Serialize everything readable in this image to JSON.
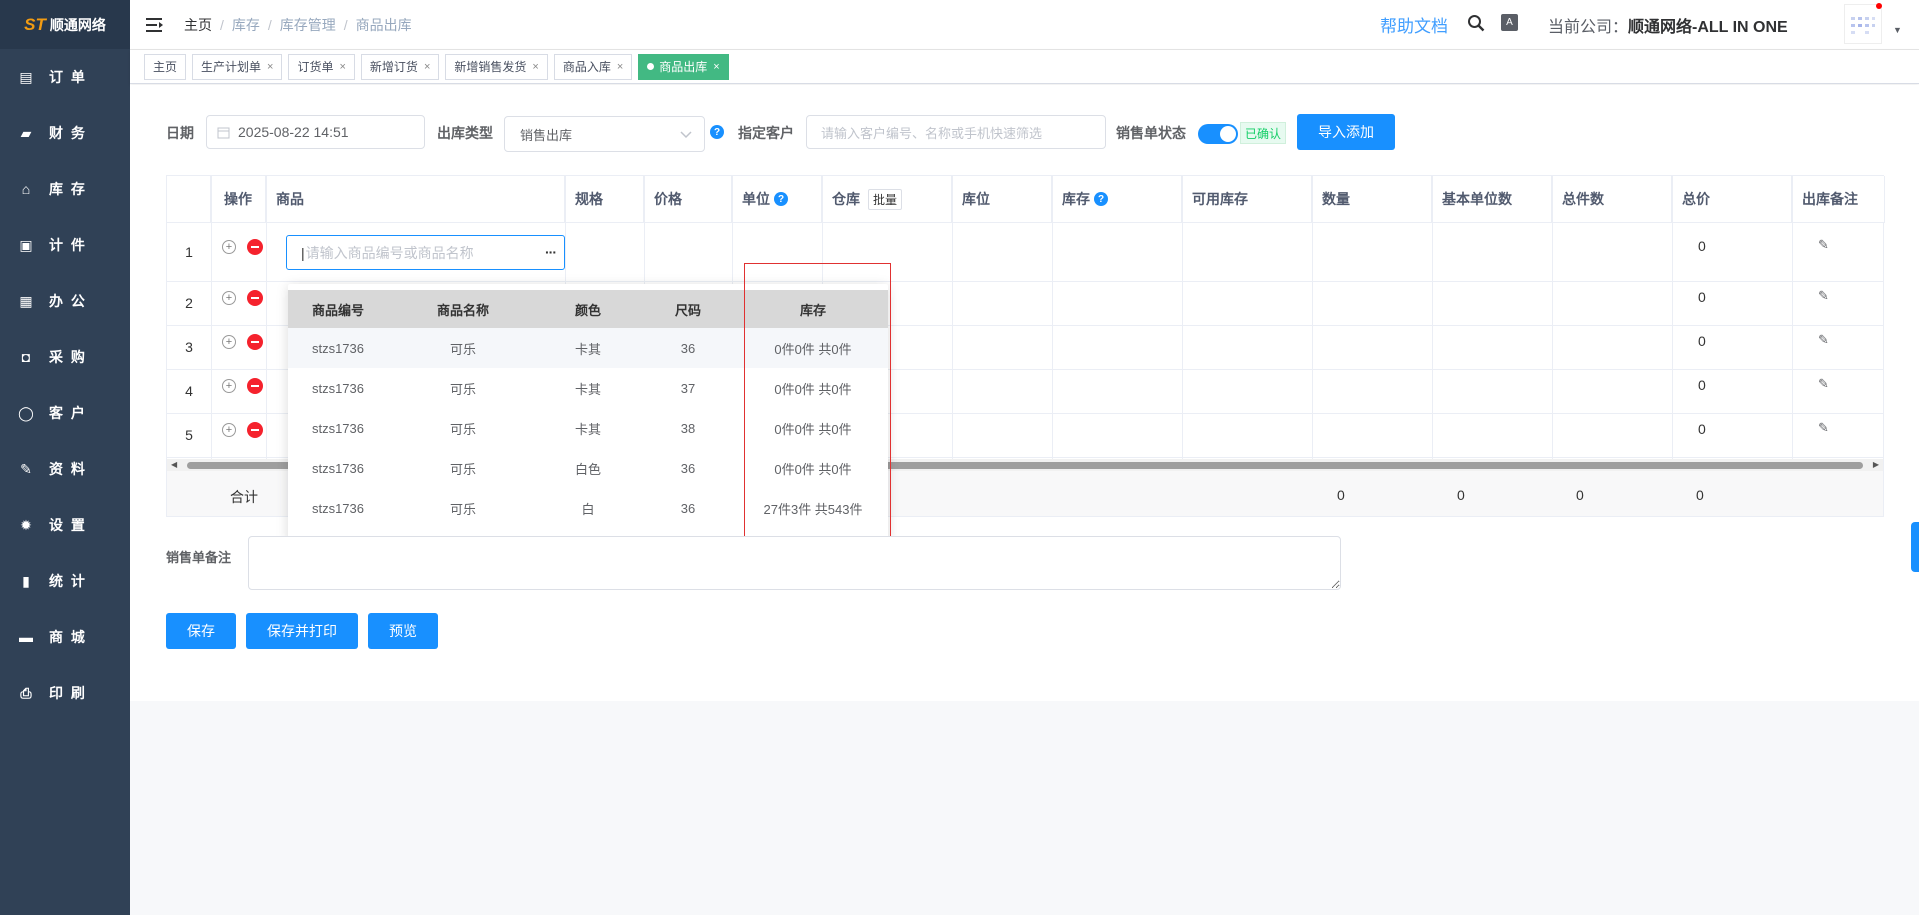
{
  "app": {
    "logo_text": "顺通网络",
    "logo_mark": "ST"
  },
  "sidebar": {
    "items": [
      {
        "label": "订 单",
        "icon": "order-icon",
        "glyph": "▤"
      },
      {
        "label": "财 务",
        "icon": "wallet-icon",
        "glyph": "▰"
      },
      {
        "label": "库 存",
        "icon": "home-icon",
        "glyph": "⌂"
      },
      {
        "label": "计 件",
        "icon": "clipboard-icon",
        "glyph": "▣"
      },
      {
        "label": "办 公",
        "icon": "calendar-icon",
        "glyph": "▦"
      },
      {
        "label": "采 购",
        "icon": "bag-icon",
        "glyph": "◘"
      },
      {
        "label": "客 户",
        "icon": "user-icon",
        "glyph": "◯"
      },
      {
        "label": "资 料",
        "icon": "pen-icon",
        "glyph": "✎"
      },
      {
        "label": "设 置",
        "icon": "gear-icon",
        "glyph": "✹"
      },
      {
        "label": "统 计",
        "icon": "bar-chart-icon",
        "glyph": "▮"
      },
      {
        "label": "商 城",
        "icon": "shop-icon",
        "glyph": "▬"
      },
      {
        "label": "印 刷",
        "icon": "printer-icon",
        "glyph": "⎙"
      }
    ]
  },
  "breadcrumb": [
    "主页",
    "库存",
    "库存管理",
    "商品出库"
  ],
  "header": {
    "help": "帮助文档",
    "company_label": "当前公司：",
    "company_name": "顺通网络-ALL IN ONE",
    "font_icon_text": "A"
  },
  "tags": [
    {
      "label": "主页",
      "closable": false,
      "active": false
    },
    {
      "label": "生产计划单",
      "closable": true,
      "active": false
    },
    {
      "label": "订货单",
      "closable": true,
      "active": false
    },
    {
      "label": "新增订货",
      "closable": true,
      "active": false
    },
    {
      "label": "新增销售发货",
      "closable": true,
      "active": false
    },
    {
      "label": "商品入库",
      "closable": true,
      "active": false
    },
    {
      "label": "商品出库",
      "closable": true,
      "active": true
    }
  ],
  "form": {
    "date_label": "日期",
    "date_value": "2025-08-22 14:51",
    "type_label": "出库类型",
    "type_value": "销售出库",
    "customer_label": "指定客户",
    "customer_placeholder": "请输入客户编号、名称或手机快速筛选",
    "status_label": "销售单状态",
    "status_text": "已确认",
    "import_button": "导入添加"
  },
  "table": {
    "headers": {
      "op": "操作",
      "product": "商品",
      "spec": "规格",
      "price": "价格",
      "unit": "单位",
      "warehouse": "仓库",
      "batch": "批量",
      "location": "库位",
      "stock": "库存",
      "available": "可用库存",
      "qty": "数量",
      "base_qty": "基本单位数",
      "total_pieces": "总件数",
      "total_price": "总价",
      "remark": "出库备注"
    },
    "rows": [
      {
        "index": "1",
        "total_price": "0"
      },
      {
        "index": "2",
        "total_price": "0"
      },
      {
        "index": "3",
        "total_price": "0"
      },
      {
        "index": "4",
        "total_price": "0"
      },
      {
        "index": "5",
        "total_price": "0"
      }
    ],
    "product_placeholder": "请输入商品编号或商品名称",
    "sum_label": "合计",
    "sum_values": {
      "qty": "0",
      "base_qty": "0",
      "total_pieces": "0",
      "total_price": "0"
    }
  },
  "dropdown": {
    "headers": [
      "商品编号",
      "商品名称",
      "颜色",
      "尺码",
      "库存"
    ],
    "rows": [
      [
        "stzs1736",
        "可乐",
        "卡其",
        "36",
        "0件0件 共0件"
      ],
      [
        "stzs1736",
        "可乐",
        "卡其",
        "37",
        "0件0件 共0件"
      ],
      [
        "stzs1736",
        "可乐",
        "卡其",
        "38",
        "0件0件 共0件"
      ],
      [
        "stzs1736",
        "可乐",
        "白色",
        "36",
        "0件0件 共0件"
      ],
      [
        "stzs1736",
        "可乐",
        "白",
        "36",
        "27件3件 共543件"
      ]
    ]
  },
  "remark": {
    "label": "销售单备注"
  },
  "actions": {
    "save": "保存",
    "save_print": "保存并打印",
    "preview": "预览"
  },
  "colors": {
    "primary": "#1890ff",
    "sidebar": "#304156",
    "active_tag": "#42b983",
    "danger": "#f5222d",
    "highlight_box": "#e03131"
  }
}
